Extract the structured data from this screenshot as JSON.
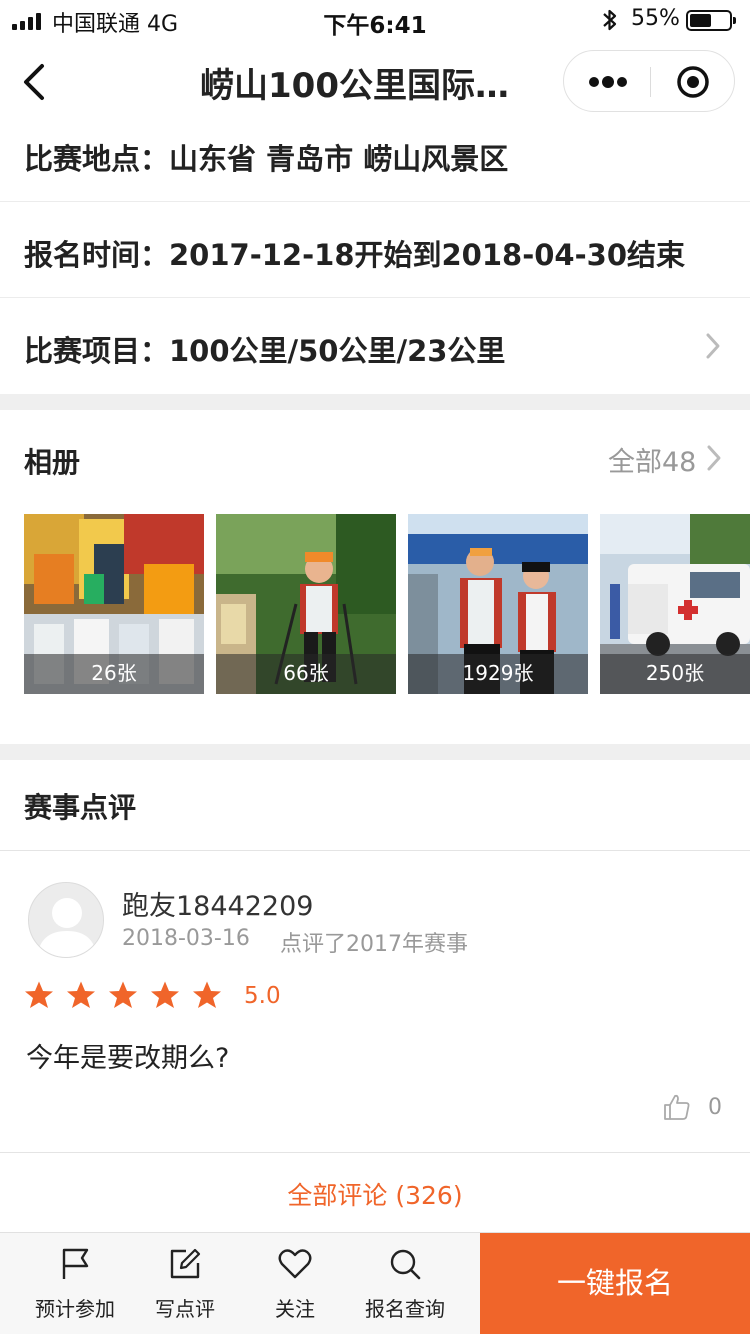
{
  "status_bar": {
    "carrier": "中国联通  4G",
    "time": "下午6:41",
    "battery_pct": "55%",
    "battery_level": 0.55
  },
  "nav": {
    "title": "崂山100公里国际…"
  },
  "info": {
    "location": "比赛地点：山东省 青岛市 崂山风景区",
    "registration": "报名时间：2017-12-18开始到2018-04-30结束",
    "events": "比赛项目：100公里/50公里/23公里"
  },
  "album": {
    "title": "相册",
    "all_label": "全部48",
    "photos": [
      {
        "count": "26张"
      },
      {
        "count": "66张"
      },
      {
        "count": "1929张"
      },
      {
        "count": "250张"
      }
    ]
  },
  "reviews": {
    "title": "赛事点评",
    "items": [
      {
        "user": "跑友18442209",
        "date": "2018-03-16",
        "meta": "点评了2017年赛事",
        "stars": 5,
        "rating": "5.0",
        "text": "今年是要改期么?",
        "likes": "0"
      }
    ],
    "all_link": "全部评论 (326)"
  },
  "bottom_bar": {
    "tabs": [
      {
        "label": "预计参加",
        "icon": "flag-icon"
      },
      {
        "label": "写点评",
        "icon": "edit-icon"
      },
      {
        "label": "关注",
        "icon": "heart-icon"
      },
      {
        "label": "报名查询",
        "icon": "search-icon"
      }
    ],
    "signup": "一键报名"
  },
  "colors": {
    "accent": "#f0652a",
    "gap": "#efefef",
    "muted": "#999999"
  }
}
